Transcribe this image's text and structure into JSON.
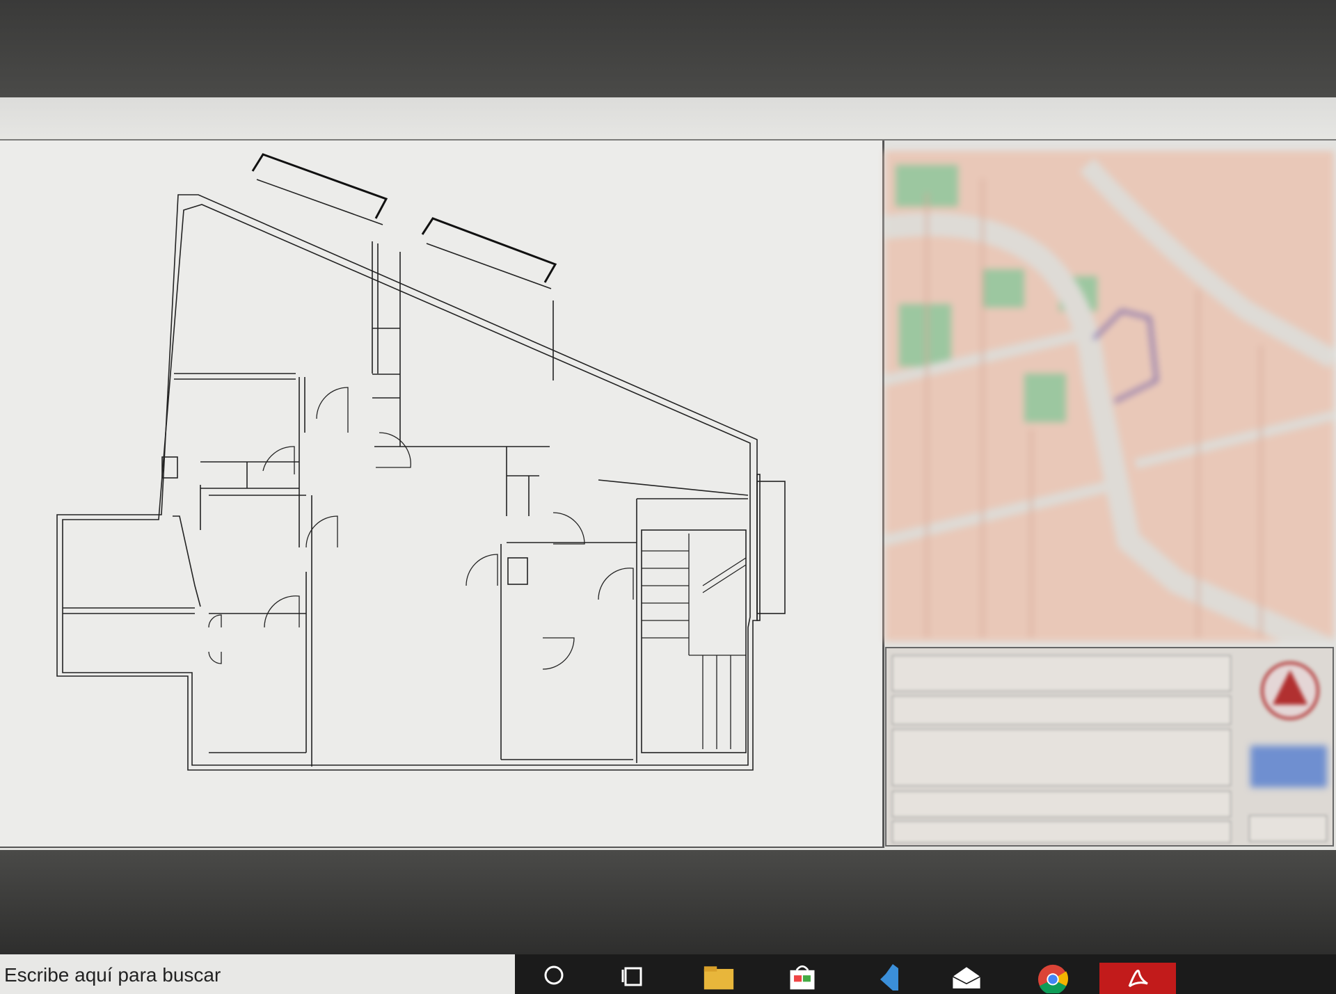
{
  "taskbar": {
    "search_placeholder": "Escribe aquí para buscar",
    "icons": [
      "search-icon",
      "task-view-icon",
      "file-explorer-icon",
      "store-icon",
      "visual-studio-icon",
      "mail-icon",
      "chrome-icon",
      "acrobat-icon"
    ]
  },
  "drawing": {
    "type": "floor-plan",
    "text_labels": []
  },
  "titlebox": {
    "content": "blurred"
  },
  "colors": {
    "paper": "#ececea",
    "map_parcel": "#e9c8b8",
    "map_green": "#9cc7a0",
    "map_road": "#dedbd6",
    "taskbar": "#1b1b1b"
  }
}
